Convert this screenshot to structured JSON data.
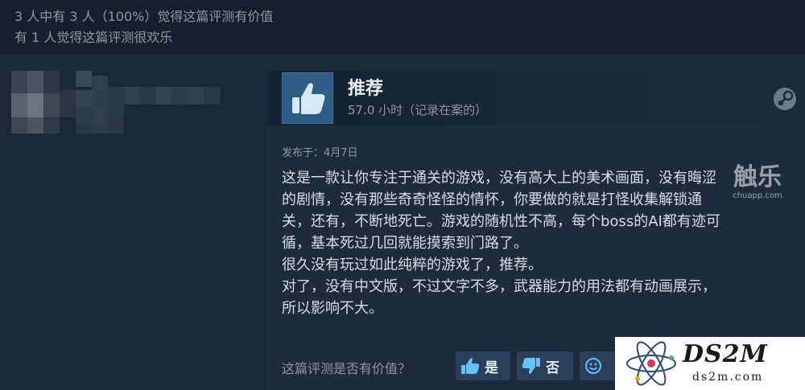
{
  "helpful": {
    "line1": "3 人中有 3 人（100%）觉得这篇评测有价值",
    "line2": "有 1 人觉得这篇评测很欢乐"
  },
  "review": {
    "title": "推荐",
    "hours": "57.0 小时（记录在案的）",
    "posted": "发布于：4月7日",
    "content": "这是一款让你专注于通关的游戏，没有高大上的美术画面，没有晦涩\n的剧情，没有那些奇奇怪怪的情怀，你要做的就是打怪收集解锁通\n关，还有，不断地死亡。游戏的随机性不高，每个boss的AI都有迹可\n循，基本死过几回就能摸索到门路了。\n很久没有玩过如此纯粹的游戏了，推荐。\n对了，没有中文版，不过文字不多，武器能力的用法都有动画展示，\n所以影响不大。",
    "question": "这篇评测是否有价值？",
    "yes_label": "是",
    "no_label": "否"
  },
  "watermarks": {
    "cn_big": "触乐",
    "cn_small": "chuapp.com",
    "brand": "DS2M",
    "brand_domain": "ds2m.com"
  },
  "icons": {
    "thumb": "thumbs-up-icon",
    "steam": "steam-icon",
    "thumb_down": "thumbs-down-icon",
    "funny": "smiley-icon"
  },
  "colors": {
    "background": "#1b2838",
    "accent": "#2f5b84",
    "text": "#d6dde3"
  }
}
